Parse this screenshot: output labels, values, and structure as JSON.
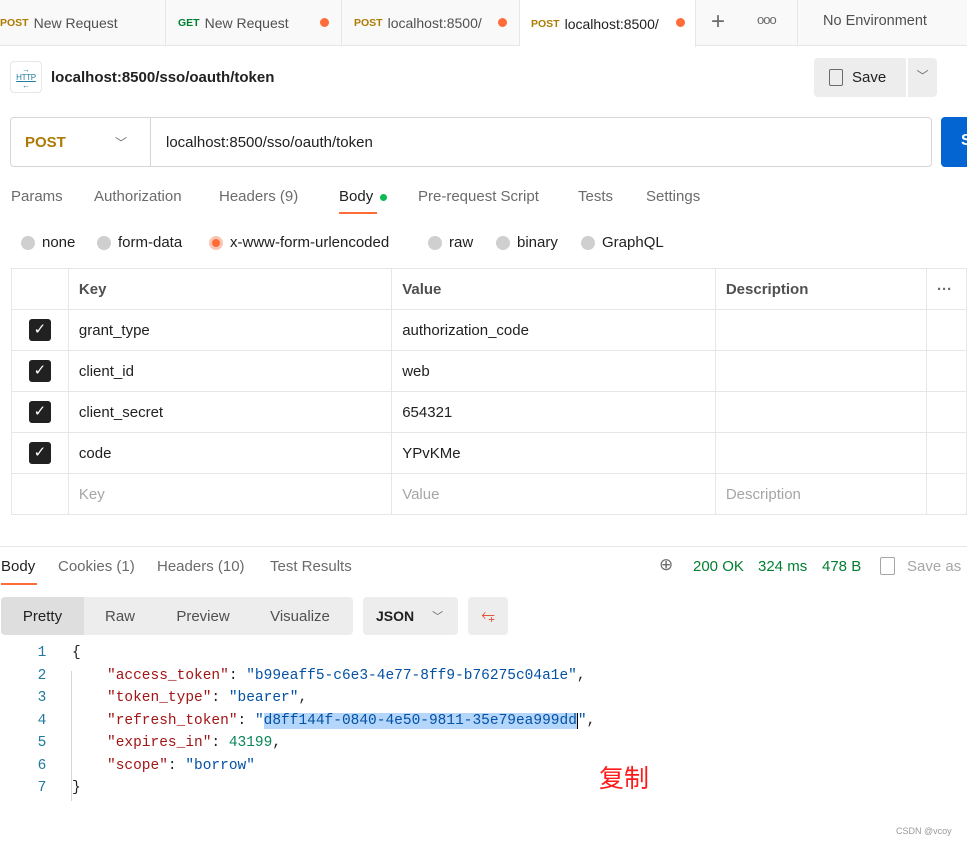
{
  "tabs": [
    {
      "method": "POST",
      "title": "New Request",
      "dirty": false
    },
    {
      "method": "GET",
      "title": "New Request",
      "dirty": true
    },
    {
      "method": "POST",
      "title": "localhost:8500/",
      "dirty": true
    },
    {
      "method": "POST",
      "title": "localhost:8500/",
      "dirty": true,
      "active": true
    }
  ],
  "environment": "No Environment",
  "request": {
    "icon_label": "HTTP",
    "name": "localhost:8500/sso/oauth/token",
    "save": "Save",
    "method": "POST",
    "url": "localhost:8500/sso/oauth/token",
    "send": "S"
  },
  "req_tabs": [
    "Params",
    "Authorization",
    "Headers (9)",
    "Body",
    "Pre-request Script",
    "Tests",
    "Settings"
  ],
  "body_types": [
    "none",
    "form-data",
    "x-www-form-urlencoded",
    "raw",
    "binary",
    "GraphQL"
  ],
  "selected_body_type": "x-www-form-urlencoded",
  "table": {
    "headers": [
      "Key",
      "Value",
      "Description"
    ],
    "rows": [
      {
        "key": "grant_type",
        "value": "authorization_code",
        "checked": true
      },
      {
        "key": "client_id",
        "value": "web",
        "checked": true
      },
      {
        "key": "client_secret",
        "value": "654321",
        "checked": true
      },
      {
        "key": "code",
        "value": "YPvKMe",
        "checked": true
      }
    ],
    "placeholder": {
      "key": "Key",
      "value": "Value",
      "description": "Description"
    }
  },
  "response": {
    "tabs": [
      "Body",
      "Cookies (1)",
      "Headers (10)",
      "Test Results"
    ],
    "status": "200 OK",
    "time": "324 ms",
    "size": "478 B",
    "save_as": "Save as",
    "views": [
      "Pretty",
      "Raw",
      "Preview",
      "Visualize"
    ],
    "format": "JSON",
    "code": {
      "open": "{",
      "close": "}",
      "access_token_key": "\"access_token\"",
      "access_token": "\"b99eaff5-c6e3-4e77-8ff9-b76275c04a1e\"",
      "token_type_key": "\"token_type\"",
      "token_type": "\"bearer\"",
      "refresh_token_key": "\"refresh_token\"",
      "refresh_token": "d8ff144f-0840-4e50-9811-35e79ea999dd",
      "expires_in_key": "\"expires_in\"",
      "expires_in": "43199",
      "scope_key": "\"scope\"",
      "scope": "\"borrow\""
    }
  },
  "annotation": "复制",
  "watermark": "CSDN @vcoy",
  "colors": {
    "accent": "#ff6c37",
    "send": "#0265d2",
    "success": "#007f31"
  }
}
